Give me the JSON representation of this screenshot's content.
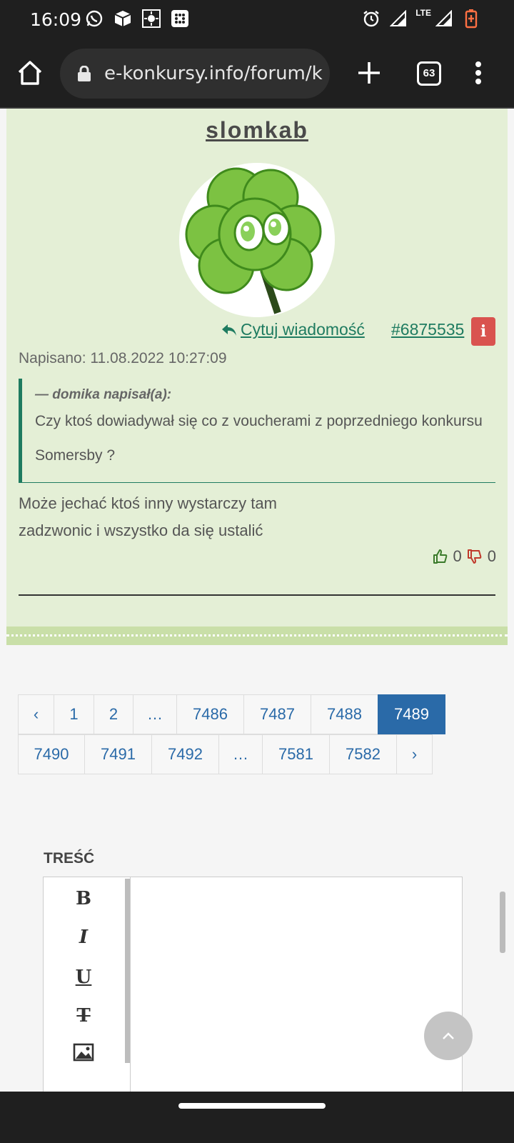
{
  "status_bar": {
    "time": "16:09",
    "network": "LTE",
    "left_icons": [
      "whatsapp-icon",
      "package-icon",
      "brightness-icon",
      "grid-app-icon"
    ],
    "right_icons": [
      "alarm-icon",
      "signal-icon",
      "signal-icon",
      "battery-icon"
    ]
  },
  "browser": {
    "url": "e-konkursy.info/forum/k",
    "tab_count": "63"
  },
  "post": {
    "author": "slomkab",
    "quote_label": "Cytuj wiadomość",
    "post_id": "#6875535",
    "report_label": "i",
    "posted_at": "Napisano: 11.08.2022 10:27:09",
    "quote": {
      "author": "— domika napisał(a):",
      "text": "Czy ktoś dowiadywał się co z voucherami z poprzedniego konkursu Somersby ?"
    },
    "body": "Może jechać ktoś inny wystarczy tam zadzwonic i wszystko da się ustalić",
    "likes": "0",
    "dislikes": "0"
  },
  "pagination": {
    "row1": [
      "‹",
      "1",
      "2",
      "…",
      "7486",
      "7487",
      "7488",
      "7489"
    ],
    "row2": [
      "7490",
      "7491",
      "7492",
      "…",
      "7581",
      "7582",
      "›"
    ],
    "active": "7489"
  },
  "editor": {
    "label": "TREŚĆ",
    "buttons": [
      "B",
      "I",
      "U",
      "T"
    ]
  }
}
